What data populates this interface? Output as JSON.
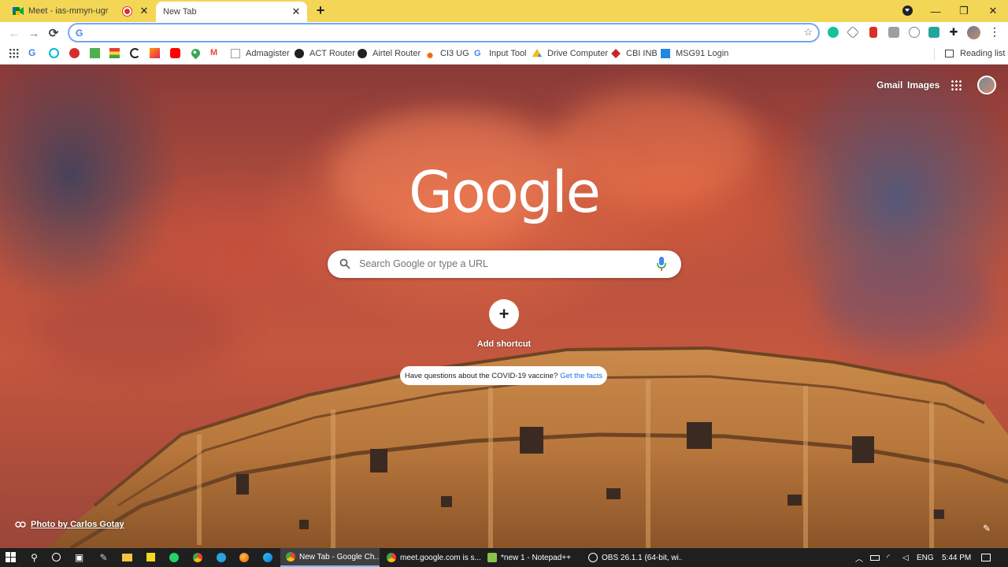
{
  "browser": {
    "tabs": [
      {
        "title": "Meet - ias-mmyn-ugr",
        "active": false,
        "recording": true
      },
      {
        "title": "New Tab",
        "active": true,
        "recording": false
      }
    ],
    "omnibox": {
      "value": "",
      "placeholder": ""
    },
    "bookmarks": [
      {
        "label": "Admagister",
        "icon": "doc-icon"
      },
      {
        "label": "ACT Router",
        "icon": "globe-icon"
      },
      {
        "label": "Airtel Router",
        "icon": "globe-icon"
      },
      {
        "label": "CI3 UG",
        "icon": "flame-icon"
      },
      {
        "label": "Input Tool",
        "icon": "google-icon"
      },
      {
        "label": "Drive Computer",
        "icon": "drive-icon"
      },
      {
        "label": "CBI INB",
        "icon": "cbi-icon"
      },
      {
        "label": "MSG91 Login",
        "icon": "msg91-icon"
      }
    ],
    "reading_list": "Reading list"
  },
  "ntp": {
    "header_links": {
      "gmail": "Gmail",
      "images": "Images"
    },
    "logo": "Google",
    "search_placeholder": "Search Google or type a URL",
    "add_shortcut": "Add shortcut",
    "promo_text": "Have questions about the COVID-19 vaccine?",
    "promo_link": "Get the facts",
    "attribution": "Photo by Carlos Gotay"
  },
  "taskbar": {
    "apps": [
      {
        "label": "New Tab - Google Ch...",
        "active": true,
        "color": "#4285f4"
      },
      {
        "label": "meet.google.com is s...",
        "active": false,
        "color": "#34a853"
      },
      {
        "label": "*new 1 - Notepad++",
        "active": false,
        "color": "#8bc34a"
      },
      {
        "label": "OBS 26.1.1 (64-bit, wi...",
        "active": false,
        "color": "#444444"
      }
    ],
    "language": "ENG",
    "time": "5:44 PM"
  },
  "colors": {
    "tabstrip": "#f3d655",
    "accent": "#1a73e8"
  }
}
